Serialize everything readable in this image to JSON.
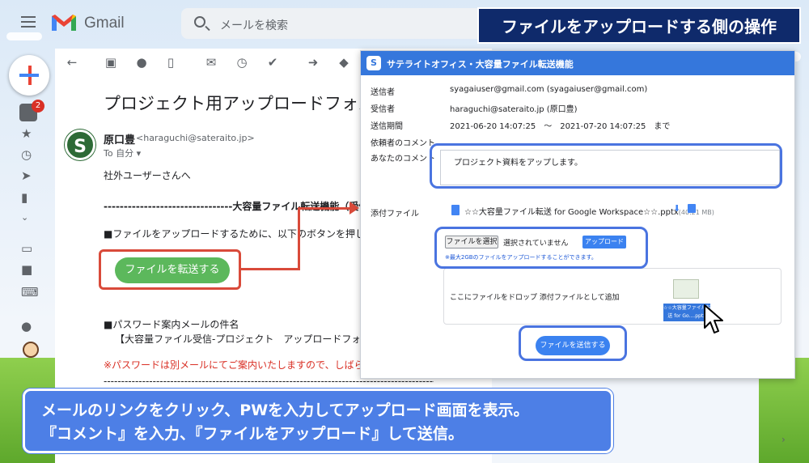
{
  "header": {
    "app_name": "Gmail",
    "search_placeholder": "メールを検索",
    "title_banner": "ファイルをアップロードする側の操作"
  },
  "left_rail": {
    "inbox_badge": "2"
  },
  "email": {
    "subject": "プロジェクト用アップロードフォルダ",
    "sender_name": "原口豊",
    "sender_email": "<haraguchi@sateraito.jp>",
    "to_line": "To 自分 ▾",
    "greeting": "社外ユーザーさんへ",
    "section_header": "--------------------------------大容量ファイル転送機能（受信）---------",
    "instruction": "■ファイルをアップロードするために、以下のボタンを押してくだ",
    "transfer_button": "ファイルを転送する",
    "pw_title": "■パスワード案内メールの件名",
    "pw_subject": "【大容量ファイル受信-プロジェクト　アップロードフォルダ】",
    "pw_warning": "※パスワードは別メールにてご案内いたしますので、しばらくお待",
    "footer_divider": "-----------------------------------------------------------------------------------------------"
  },
  "panel": {
    "title": "サテライトオフィス・大容量ファイル転送機能",
    "logo_glyph": "S",
    "sender_label": "送信者",
    "sender_value": "syagaiuser@gmail.com (syagaiuser@gmail.com)",
    "recipient_label": "受信者",
    "recipient_value": "haraguchi@sateraito.jp (原口豊)",
    "period_label": "送信期間",
    "period_value": "2021-06-20 14:07:25　～　2021-07-20 14:07:25　まで",
    "requester_comment_label": "依頼者のコメント",
    "your_comment_label": "あなたのコメント",
    "comment_text": "プロジェクト資料をアップします。",
    "attachment_label": "添付ファイル",
    "attachment_name": "☆☆大容量ファイル転送 for Google Workspace☆☆.pptx",
    "attachment_size": "(40.21 MB)",
    "choose_file_button": "ファイルを選択",
    "no_file_selected": "選択されていません",
    "upload_button": "アップロード",
    "max_size_note": "※最大2GBのファイルをアップロードすることができます。",
    "drop_text": "ここにファイルをドロップ 添付ファイルとして追加",
    "drag_label_1": "☆☆大容量ファイル転",
    "drag_label_2": "送 for Go....pptx",
    "send_button": "ファイルを送信する"
  },
  "instructions": {
    "line1": "メールのリンクをクリック、PWを入力してアップロード画面を表示。",
    "line2": "『コメント』を入力、『ファイルをアップロード』して送信。"
  },
  "colors": {
    "banner_bg": "#0f2a6b",
    "panel_header": "#3577dc",
    "transfer_button": "#5cb85c",
    "red_highlight": "#d94a3a",
    "blue_highlight": "#4a74e0",
    "instruction_bg": "#4d7fe6"
  },
  "icons": [
    "menu-icon",
    "search-icon",
    "compose-icon",
    "inbox-icon",
    "star-icon",
    "clock-icon",
    "send-icon",
    "file-icon",
    "back-icon",
    "archive-icon",
    "report-icon",
    "delete-icon",
    "download-icon",
    "trash-icon",
    "cursor-icon"
  ]
}
